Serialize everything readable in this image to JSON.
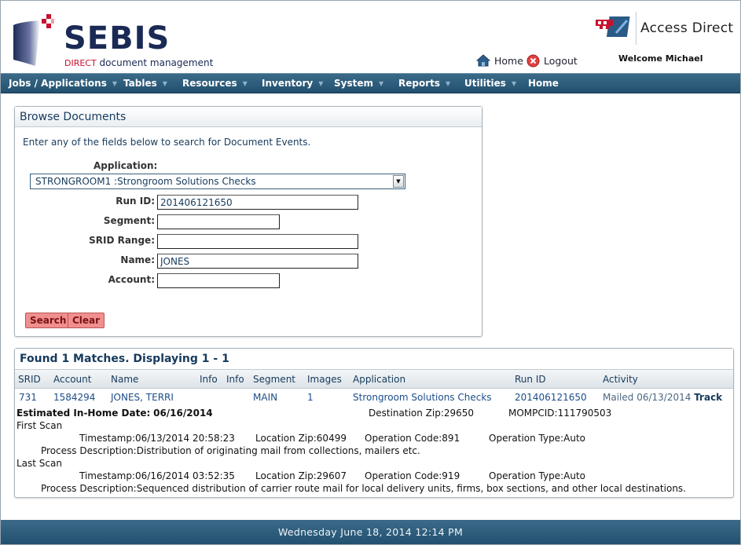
{
  "header": {
    "logo_title": "SEBIS",
    "logo_sub_red": "DIRECT",
    "logo_sub_rest": "document management",
    "access_direct": "Access Direct",
    "home_label": "Home",
    "logout_label": "Logout",
    "welcome": "Welcome Michael"
  },
  "menu": [
    "Jobs / Applications",
    "Tables",
    "Resources",
    "Inventory",
    "System",
    "Reports",
    "Utilities",
    "Home"
  ],
  "browse": {
    "title": "Browse Documents",
    "intro": "Enter any of the fields below to search for Document Events.",
    "application_label": "Application:",
    "application_value": "STRONGROOM1 :Strongroom Solutions Checks",
    "runid_label": "Run ID:",
    "runid_value": "201406121650",
    "segment_label": "Segment:",
    "segment_value": "",
    "srid_label": "SRID Range:",
    "srid_value": "",
    "name_label": "Name:",
    "name_value": "JONES",
    "account_label": "Account:",
    "account_value": "",
    "search_button": "Search",
    "clear_button": "Clear"
  },
  "results": {
    "title": "Found 1 Matches. Displaying 1 - 1",
    "columns": [
      "SRID",
      "Account",
      "Name",
      "Info",
      "Info",
      "Segment",
      "Images",
      "Application",
      "Run ID",
      "Activity"
    ],
    "row": {
      "srid": "731",
      "account": "1584294",
      "name": "JONES, TERRI",
      "segment": "MAIN",
      "images": "1",
      "application": "Strongroom Solutions Checks",
      "run_id": "201406121650",
      "activity": "Mailed 06/13/2014",
      "track": "Track"
    },
    "details": {
      "est_inhome_label": "Estimated In-Home Date:",
      "est_inhome_value": "06/16/2014",
      "dest_zip_label": "Destination Zip:",
      "dest_zip_value": "29650",
      "mompcid_label": "MOMPCID:",
      "mompcid_value": "111790503",
      "first_scan": "First Scan",
      "last_scan": "Last Scan",
      "timestamp_label": "Timestamp:",
      "location_zip_label": "Location Zip:",
      "op_code_label": "Operation Code:",
      "op_type_label": "Operation Type:",
      "process_desc_label": "Process Description:",
      "first": {
        "timestamp": "06/13/2014 20:58:23",
        "location_zip": "60499",
        "op_code": "891",
        "op_type": "Auto",
        "process_desc": "Distribution of originating mail from collections, mailers etc."
      },
      "last": {
        "timestamp": "06/16/2014 03:52:35",
        "location_zip": "29607",
        "op_code": "919",
        "op_type": "Auto",
        "process_desc": "Sequenced distribution of carrier route mail for local delivery units, firms, box sections, and other local destinations."
      }
    }
  },
  "footer": {
    "datetime": "Wednesday June 18, 2014 12:14 PM"
  },
  "colors": {
    "menu_bar": "#2f5d7c",
    "accent_text": "#163a5c",
    "link": "#1c4d8a",
    "button": "#f08f8f"
  }
}
